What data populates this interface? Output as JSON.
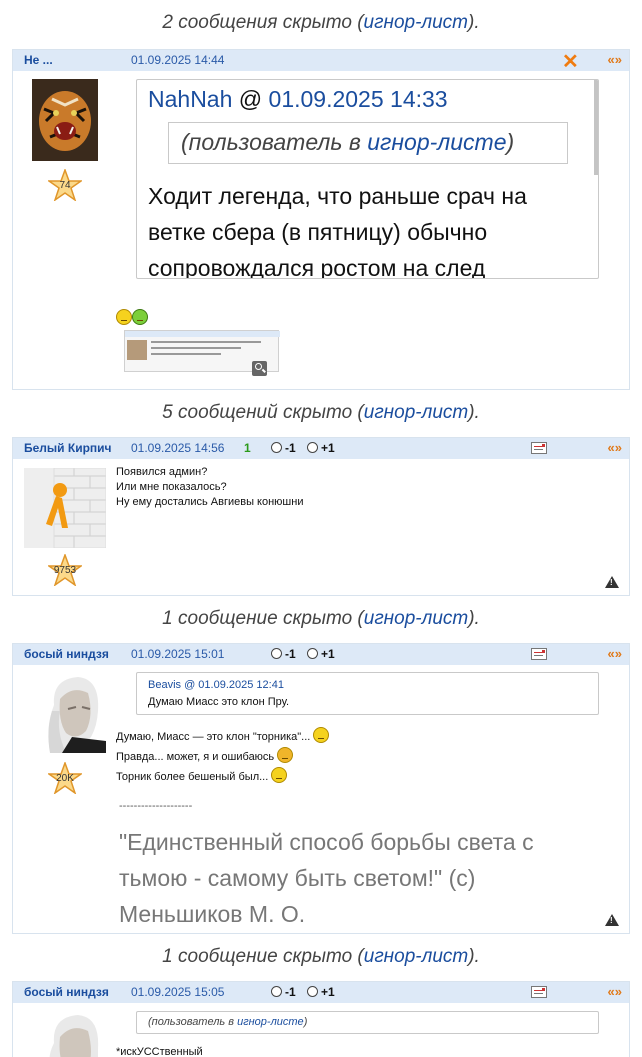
{
  "notes": [
    {
      "prefix": "2 сообщения скрыто (",
      "link": "игнор-лист",
      "suffix": ")."
    },
    {
      "prefix": "5 сообщений скрыто (",
      "link": "игнор-лист",
      "suffix": ")."
    },
    {
      "prefix": "1 сообщение скрыто (",
      "link": "игнор-лист",
      "suffix": ")."
    },
    {
      "prefix": "1 сообщение скрыто (",
      "link": "игнор-лист",
      "suffix": ")."
    }
  ],
  "posts": [
    {
      "author": "Не ...",
      "date": "01.09.2025 14:44",
      "quote_link": "«»",
      "close_icon": "✕",
      "rating": "74",
      "quote_author": "NahNah",
      "quote_at": " @ ",
      "quote_date": "01.09.2025 14:33",
      "ignored_prefix": "(пользователь в ",
      "ignored_link": "игнор-листе",
      "ignored_suffix": ")",
      "quote_text": "Ходит легенда, что раньше срач на ветке сбера (в пятницу) обычно сопровождался ростом на след"
    },
    {
      "author": "Белый Кирпич",
      "date": "01.09.2025 14:56",
      "count": "1",
      "vote_minus": "-1",
      "vote_plus": "+1",
      "quote_link": "«»",
      "rating": "9753",
      "lines": [
        "Появился админ?",
        "Или мне показалось?",
        "Ну ему достались Авгиевы конюшни"
      ]
    },
    {
      "author": "босый ниндзя",
      "date": "01.09.2025 15:01",
      "vote_minus": "-1",
      "vote_plus": "+1",
      "quote_link": "«»",
      "rating": "20K",
      "quote_author": "Beavis @ 01.09.2025 12:41",
      "quote_text": "Думаю Миасс это клон Пру.",
      "lines": [
        "Думаю, Миасс — это клон \"торника\"...",
        "Правда... может, я и ошибаюсь",
        "Торник более бешеный был..."
      ],
      "separator": "--------------------",
      "signature": "\"Единственный способ борьбы света с тьмою - самому быть светом!\" (с) Меньшиков М. О."
    },
    {
      "author": "босый ниндзя",
      "date": "01.09.2025 15:05",
      "vote_minus": "-1",
      "vote_plus": "+1",
      "quote_link": "«»",
      "ignored_prefix": "(пользователь в ",
      "ignored_link": "игнор-листе",
      "ignored_suffix": ")",
      "lines": [
        "*искУССтвенный"
      ]
    }
  ]
}
